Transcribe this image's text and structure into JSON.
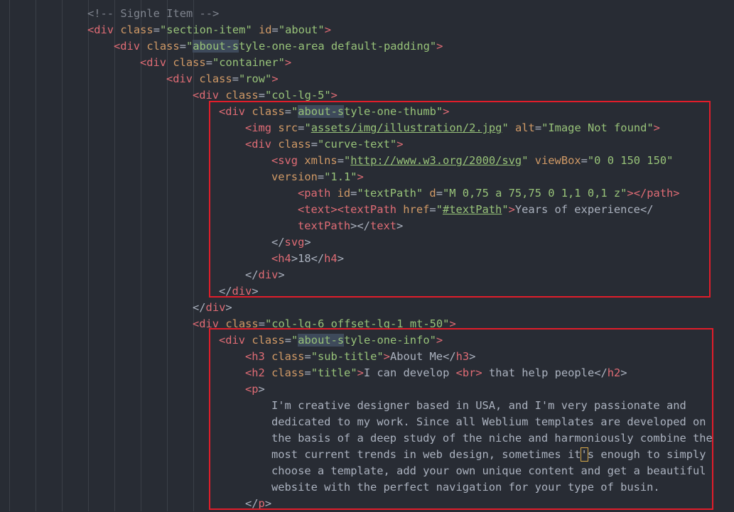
{
  "lines": [
    {
      "indent": 0,
      "tokens": [
        [
          "cmt",
          "<!-- Signle Item -->"
        ]
      ]
    },
    {
      "indent": 0,
      "tokens": [
        [
          "tag",
          "<div"
        ],
        [
          "txt",
          " "
        ],
        [
          "attr",
          "class"
        ],
        [
          "txt",
          "="
        ],
        [
          "str",
          "\"section-item\""
        ],
        [
          "txt",
          " "
        ],
        [
          "attr",
          "id"
        ],
        [
          "txt",
          "="
        ],
        [
          "str",
          "\"about\""
        ],
        [
          "tag",
          ">"
        ]
      ]
    },
    {
      "indent": 1,
      "tokens": [
        [
          "tag",
          "<div"
        ],
        [
          "txt",
          " "
        ],
        [
          "attr",
          "class"
        ],
        [
          "txt",
          "="
        ],
        [
          "str",
          "\""
        ],
        [
          "strhl",
          "about-s"
        ],
        [
          "str",
          "tyle-one-area default-padding\""
        ],
        [
          "tag",
          ">"
        ]
      ]
    },
    {
      "indent": 2,
      "tokens": [
        [
          "tag",
          "<div"
        ],
        [
          "txt",
          " "
        ],
        [
          "attr",
          "class"
        ],
        [
          "txt",
          "="
        ],
        [
          "str",
          "\"container\""
        ],
        [
          "tag",
          ">"
        ]
      ]
    },
    {
      "indent": 3,
      "tokens": [
        [
          "tag",
          "<div"
        ],
        [
          "txt",
          " "
        ],
        [
          "attr",
          "class"
        ],
        [
          "txt",
          "="
        ],
        [
          "str",
          "\"row\""
        ],
        [
          "tag",
          ">"
        ]
      ]
    },
    {
      "indent": 4,
      "tokens": [
        [
          "tag",
          "<div"
        ],
        [
          "txt",
          " "
        ],
        [
          "attr",
          "class"
        ],
        [
          "txt",
          "="
        ],
        [
          "str",
          "\"col-lg-5\""
        ],
        [
          "tag",
          ">"
        ]
      ]
    },
    {
      "indent": 5,
      "tokens": [
        [
          "tag",
          "<div"
        ],
        [
          "txt",
          " "
        ],
        [
          "attr",
          "class"
        ],
        [
          "txt",
          "="
        ],
        [
          "str",
          "\""
        ],
        [
          "strhl",
          "about-s"
        ],
        [
          "str",
          "tyle-one-thumb\""
        ],
        [
          "tag",
          ">"
        ]
      ]
    },
    {
      "indent": 6,
      "tokens": [
        [
          "tag",
          "<img"
        ],
        [
          "txt",
          " "
        ],
        [
          "attr",
          "src"
        ],
        [
          "txt",
          "="
        ],
        [
          "str",
          "\""
        ],
        [
          "url",
          "assets/img/illustration/2.jpg"
        ],
        [
          "str",
          "\""
        ],
        [
          "txt",
          " "
        ],
        [
          "attr",
          "alt"
        ],
        [
          "txt",
          "="
        ],
        [
          "str",
          "\"Image Not found\""
        ],
        [
          "tag",
          ">"
        ]
      ]
    },
    {
      "indent": 6,
      "tokens": [
        [
          "tag",
          "<div"
        ],
        [
          "txt",
          " "
        ],
        [
          "attr",
          "class"
        ],
        [
          "txt",
          "="
        ],
        [
          "str",
          "\"curve-text\""
        ],
        [
          "tag",
          ">"
        ]
      ]
    },
    {
      "indent": 7,
      "tokens": [
        [
          "tag",
          "<svg"
        ],
        [
          "txt",
          " "
        ],
        [
          "attr",
          "xmlns"
        ],
        [
          "txt",
          "="
        ],
        [
          "str",
          "\""
        ],
        [
          "url",
          "http://www.w3.org/2000/svg"
        ],
        [
          "str",
          "\""
        ],
        [
          "txt",
          " "
        ],
        [
          "attr",
          "viewBox"
        ],
        [
          "txt",
          "="
        ],
        [
          "str",
          "\"0 0 150 150\""
        ]
      ]
    },
    {
      "indent": 7,
      "tokens": [
        [
          "attr",
          "version"
        ],
        [
          "txt",
          "="
        ],
        [
          "str",
          "\"1.1\""
        ],
        [
          "tag",
          ">"
        ]
      ]
    },
    {
      "indent": 8,
      "tokens": [
        [
          "tag",
          "<path"
        ],
        [
          "txt",
          " "
        ],
        [
          "attr",
          "id"
        ],
        [
          "txt",
          "="
        ],
        [
          "str",
          "\"textPath\""
        ],
        [
          "txt",
          " "
        ],
        [
          "attr",
          "d"
        ],
        [
          "txt",
          "="
        ],
        [
          "str",
          "\"M 0,75 a 75,75 0 1,1 0,1 z\""
        ],
        [
          "tag",
          "></path>"
        ]
      ]
    },
    {
      "indent": 8,
      "tokens": [
        [
          "tag",
          "<text><textPath"
        ],
        [
          "txt",
          " "
        ],
        [
          "attr",
          "href"
        ],
        [
          "txt",
          "="
        ],
        [
          "str",
          "\""
        ],
        [
          "url",
          "#textPath"
        ],
        [
          "str",
          "\""
        ],
        [
          "tag",
          ">"
        ],
        [
          "txt",
          "Years of experience</"
        ]
      ]
    },
    {
      "indent": 8,
      "tokens": [
        [
          "tag",
          "textPath"
        ],
        [
          "txt",
          "></"
        ],
        [
          "tag",
          "text"
        ],
        [
          "txt",
          ">"
        ]
      ]
    },
    {
      "indent": 7,
      "tokens": [
        [
          "txt",
          "</"
        ],
        [
          "tag",
          "svg"
        ],
        [
          "txt",
          ">"
        ]
      ]
    },
    {
      "indent": 7,
      "tokens": [
        [
          "tag",
          "<h4"
        ],
        [
          "txt",
          ">18</"
        ],
        [
          "tag",
          "h4"
        ],
        [
          "txt",
          ">"
        ]
      ]
    },
    {
      "indent": 6,
      "tokens": [
        [
          "txt",
          "</"
        ],
        [
          "tag",
          "div"
        ],
        [
          "txt",
          ">"
        ]
      ]
    },
    {
      "indent": 5,
      "tokens": [
        [
          "txt",
          "</"
        ],
        [
          "tag",
          "div"
        ],
        [
          "txt",
          ">"
        ]
      ]
    },
    {
      "indent": 4,
      "tokens": [
        [
          "txt",
          "</"
        ],
        [
          "tag",
          "div"
        ],
        [
          "txt",
          ">"
        ]
      ]
    },
    {
      "indent": 4,
      "tokens": [
        [
          "tag",
          "<div"
        ],
        [
          "txt",
          " "
        ],
        [
          "attr",
          "class"
        ],
        [
          "txt",
          "="
        ],
        [
          "str",
          "\"col-lg-6 offset-lg-1 mt-50\""
        ],
        [
          "tag",
          ">"
        ]
      ]
    },
    {
      "indent": 5,
      "tokens": [
        [
          "tag",
          "<div"
        ],
        [
          "txt",
          " "
        ],
        [
          "attr",
          "class"
        ],
        [
          "txt",
          "="
        ],
        [
          "str",
          "\""
        ],
        [
          "strhl",
          "about-s"
        ],
        [
          "str",
          "tyle-one-info\""
        ],
        [
          "tag",
          ">"
        ]
      ]
    },
    {
      "indent": 6,
      "tokens": [
        [
          "tag",
          "<h3"
        ],
        [
          "txt",
          " "
        ],
        [
          "attr",
          "class"
        ],
        [
          "txt",
          "="
        ],
        [
          "str",
          "\"sub-title\""
        ],
        [
          "tag",
          ">"
        ],
        [
          "txt",
          "About Me</"
        ],
        [
          "tag",
          "h3"
        ],
        [
          "txt",
          ">"
        ]
      ]
    },
    {
      "indent": 6,
      "tokens": [
        [
          "tag",
          "<h2"
        ],
        [
          "txt",
          " "
        ],
        [
          "attr",
          "class"
        ],
        [
          "txt",
          "="
        ],
        [
          "str",
          "\"title\""
        ],
        [
          "tag",
          ">"
        ],
        [
          "txt",
          "I can develop "
        ],
        [
          "tag",
          "<br>"
        ],
        [
          "txt",
          " that help people</"
        ],
        [
          "tag",
          "h2"
        ],
        [
          "txt",
          ">"
        ]
      ]
    },
    {
      "indent": 6,
      "tokens": [
        [
          "tag",
          "<p"
        ],
        [
          "txt",
          ">"
        ]
      ]
    },
    {
      "indent": 7,
      "tokens": [
        [
          "txt",
          "I'm creative designer based in USA, and I'm very passionate and"
        ]
      ]
    },
    {
      "indent": 7,
      "tokens": [
        [
          "txt",
          "dedicated to my work. Since all Weblium templates are developed on"
        ]
      ]
    },
    {
      "indent": 7,
      "tokens": [
        [
          "txt",
          "the basis of a deep study of the niche and harmoniously combine the"
        ]
      ]
    },
    {
      "indent": 7,
      "tokens": [
        [
          "txt",
          "most current trends in web design, sometimes it"
        ],
        [
          "bracket",
          "'"
        ],
        [
          "txt",
          "s enough to simply"
        ]
      ]
    },
    {
      "indent": 7,
      "tokens": [
        [
          "txt",
          "choose a template, add your own unique content and get a beautiful"
        ]
      ]
    },
    {
      "indent": 7,
      "tokens": [
        [
          "txt",
          "website with the perfect navigation for your type of busin."
        ]
      ]
    },
    {
      "indent": 6,
      "tokens": [
        [
          "txt",
          "</"
        ],
        [
          "tag",
          "p"
        ],
        [
          "txt",
          ">"
        ]
      ]
    }
  ]
}
